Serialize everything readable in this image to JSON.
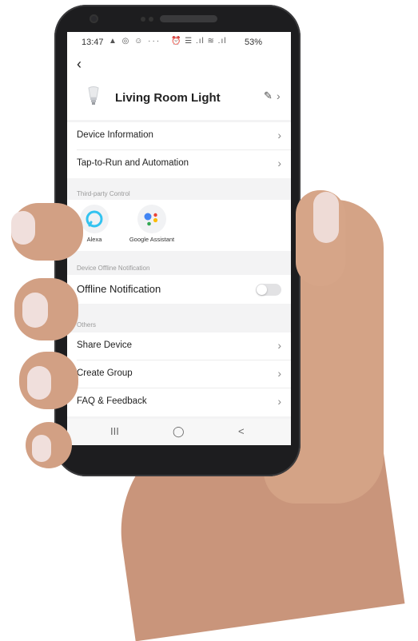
{
  "status_bar": {
    "time": "13:47",
    "left_icons": "▲ ◎ ☺ ···",
    "right_icons": "⏰ ☰ .ıl ≋ .ıl",
    "battery": "53%"
  },
  "device": {
    "name": "Living Room Light",
    "icon": "bulb-icon"
  },
  "menu": {
    "device_information": "Device Information",
    "tap_to_run": "Tap-to-Run and Automation"
  },
  "third_party": {
    "section_title": "Third-party Control",
    "items": [
      {
        "label": "Alexa",
        "icon": "alexa-icon"
      },
      {
        "label": "Google Assistant",
        "icon": "google-assistant-icon"
      }
    ]
  },
  "offline": {
    "section_title": "Device Offline Notification",
    "label": "Offline Notification",
    "enabled": false
  },
  "others": {
    "section_title": "Others",
    "share_device": "Share Device",
    "create_group": "Create Group",
    "faq_feedback": "FAQ & Feedback"
  },
  "nav": {
    "recents": "III",
    "home": "◯",
    "back": "<"
  },
  "colors": {
    "alexa_blue": "#33c3f0",
    "google_blue": "#4285f4",
    "google_red": "#ea4335",
    "google_yellow": "#fbbc05",
    "google_green": "#34a853"
  }
}
